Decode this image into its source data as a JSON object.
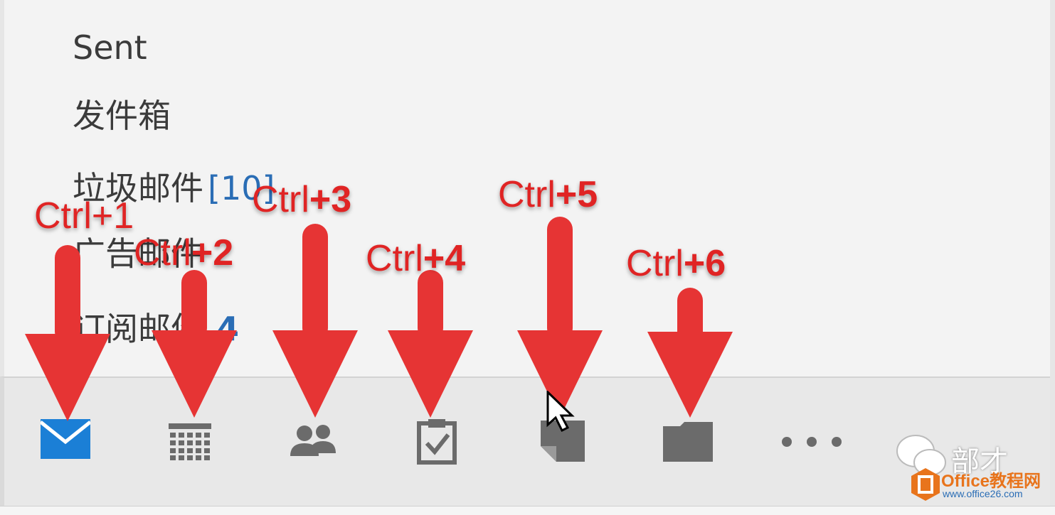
{
  "folders": [
    {
      "name": "Sent",
      "count": ""
    },
    {
      "name": "发件箱",
      "count": ""
    },
    {
      "name": "垃圾邮件",
      "count": "[10]"
    },
    {
      "name": "广告邮件",
      "count": ""
    },
    {
      "name": "订阅邮件",
      "count": "4"
    }
  ],
  "nav": {
    "mail_icon": "mail-icon",
    "calendar_icon": "calendar-icon",
    "people_icon": "people-icon",
    "tasks_icon": "tasks-icon",
    "notes_icon": "notes-icon",
    "folders_icon": "folder-icon",
    "more_label": "• • •"
  },
  "annotations": [
    {
      "prefix": "Ctrl",
      "key": "+1"
    },
    {
      "prefix": "Ctrl",
      "key": "+2"
    },
    {
      "prefix": "Ctrl",
      "key": "+3"
    },
    {
      "prefix": "Ctrl",
      "key": "+4"
    },
    {
      "prefix": "Ctrl",
      "key": "+5"
    },
    {
      "prefix": "Ctrl",
      "key": "+6"
    }
  ],
  "watermark": {
    "wechat_text": "部才",
    "brand_text": "Office教程网",
    "url_text": "www.office26.com"
  },
  "colors": {
    "accent_blue": "#1b7fd6",
    "icon_gray": "#6b6b6b",
    "annotation_red": "#e63434"
  }
}
